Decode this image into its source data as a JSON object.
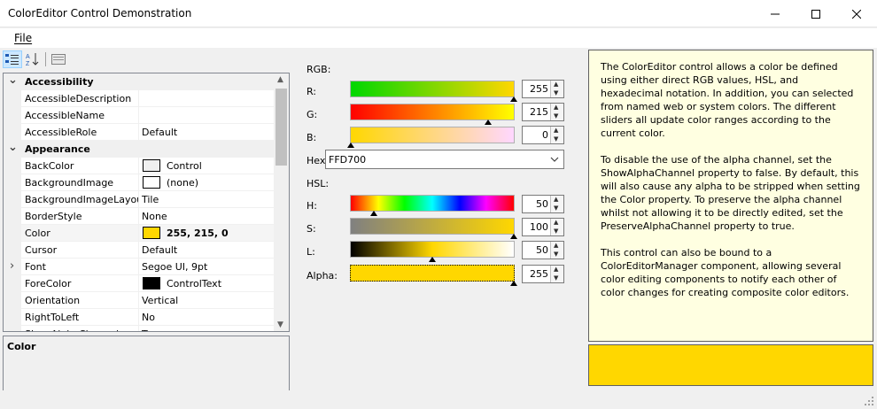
{
  "window": {
    "title": "ColorEditor Control Demonstration"
  },
  "menu": {
    "file": "File"
  },
  "property_grid": {
    "rows": [
      {
        "type": "cat",
        "name": "Accessibility",
        "value": ""
      },
      {
        "type": "prop",
        "name": "AccessibleDescription",
        "value": ""
      },
      {
        "type": "prop",
        "name": "AccessibleName",
        "value": ""
      },
      {
        "type": "prop",
        "name": "AccessibleRole",
        "value": "Default"
      },
      {
        "type": "cat",
        "name": "Appearance",
        "value": ""
      },
      {
        "type": "prop",
        "name": "BackColor",
        "value": "Control",
        "swatch": "#f0f0f0"
      },
      {
        "type": "prop",
        "name": "BackgroundImage",
        "value": "(none)",
        "swatch": "#ffffff"
      },
      {
        "type": "prop",
        "name": "BackgroundImageLayout",
        "value": "Tile"
      },
      {
        "type": "prop",
        "name": "BorderStyle",
        "value": "None"
      },
      {
        "type": "prop",
        "name": "Color",
        "value": "255, 215, 0",
        "swatch": "#ffd700",
        "bold": true
      },
      {
        "type": "prop",
        "name": "Cursor",
        "value": "Default"
      },
      {
        "type": "prop",
        "name": "Font",
        "value": "Segoe UI, 9pt",
        "expandable": true
      },
      {
        "type": "prop",
        "name": "ForeColor",
        "value": "ControlText",
        "swatch": "#000000"
      },
      {
        "type": "prop",
        "name": "Orientation",
        "value": "Vertical"
      },
      {
        "type": "prop",
        "name": "RightToLeft",
        "value": "No"
      },
      {
        "type": "prop",
        "name": "ShowAlphaChannel",
        "value": "True"
      }
    ],
    "help_title": "Color"
  },
  "editor": {
    "rgb_label": "RGB:",
    "r_label": "R:",
    "r_value": "255",
    "g_label": "G:",
    "g_value": "215",
    "b_label": "B:",
    "b_value": "0",
    "hex_label": "Hex:",
    "hex_value": "FFD700",
    "hsl_label": "HSL:",
    "h_label": "H:",
    "h_value": "50",
    "s_label": "S:",
    "s_value": "100",
    "l_label": "L:",
    "l_value": "50",
    "alpha_label": "Alpha:",
    "alpha_value": "255"
  },
  "description": {
    "p1": "The ColorEditor control allows a color be defined using either direct RGB values, HSL, and hexadecimal notation. In addition, you can selected from named web or system colors. The different sliders all update color ranges according to the current color.",
    "p2": "To disable the use of the alpha channel, set the ShowAlphaChannel property to false. By default, this will also cause any alpha to be stripped when setting the Color property. To preserve the alpha channel whilst not allowing it to be directly edited, set the PreserveAlphaChannel property to true.",
    "p3": "This control can also be bound to a ColorEditorManager component, allowing several color editing components to notify each other of color changes for creating composite color editors."
  },
  "colors": {
    "current": "#ffd700",
    "accent": "#cce8ff"
  },
  "icons": [
    "categorized-icon",
    "alphabetical-icon",
    "property-pages-icon",
    "minimize-icon",
    "maximize-icon",
    "close-icon",
    "chevron-down-icon"
  ]
}
